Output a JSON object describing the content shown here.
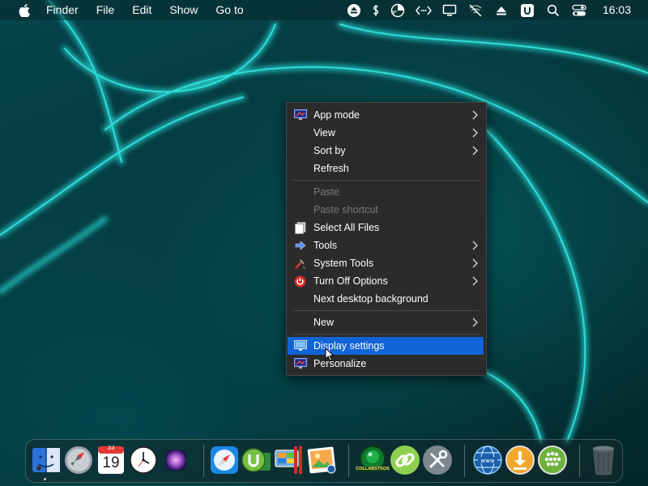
{
  "menubar": {
    "app_name": "Finder",
    "menus": [
      "File",
      "Edit",
      "Show",
      "Go to"
    ],
    "status_icons": [
      "eject-icon",
      "dollar-icon",
      "pie-chart-icon",
      "code-arrows-icon",
      "display-icon",
      "mute-network-icon",
      "upload-icon",
      "u-badge-icon",
      "search-icon",
      "control-center-icon"
    ],
    "clock": "16:03"
  },
  "context_menu": {
    "groups": [
      [
        {
          "label": "App mode",
          "icon": "app-mode-icon",
          "submenu": true,
          "enabled": true
        },
        {
          "label": "View",
          "icon": "",
          "submenu": true,
          "enabled": true
        },
        {
          "label": "Sort by",
          "icon": "",
          "submenu": true,
          "enabled": true
        },
        {
          "label": "Refresh",
          "icon": "",
          "submenu": false,
          "enabled": true
        }
      ],
      [
        {
          "label": "Paste",
          "icon": "",
          "submenu": false,
          "enabled": false
        },
        {
          "label": "Paste shortcut",
          "icon": "",
          "submenu": false,
          "enabled": false
        },
        {
          "label": "Select All Files",
          "icon": "select-files-icon",
          "submenu": false,
          "enabled": true
        },
        {
          "label": "Tools",
          "icon": "tools-arrow-icon",
          "submenu": true,
          "enabled": true
        },
        {
          "label": "System Tools",
          "icon": "system-tools-icon",
          "submenu": true,
          "enabled": true
        },
        {
          "label": "Turn Off Options",
          "icon": "power-icon",
          "submenu": true,
          "enabled": true
        },
        {
          "label": "Next desktop background",
          "icon": "",
          "submenu": false,
          "enabled": true
        }
      ],
      [
        {
          "label": "New",
          "icon": "",
          "submenu": true,
          "enabled": true
        }
      ],
      [
        {
          "label": "Display settings",
          "icon": "display-settings-icon",
          "submenu": false,
          "enabled": true,
          "selected": true
        },
        {
          "label": "Personalize",
          "icon": "personalize-icon",
          "submenu": false,
          "enabled": true
        }
      ]
    ]
  },
  "dock": {
    "calendar_month": "Jul",
    "calendar_day": "19",
    "collab_label": "COLLABSTSOS",
    "items": [
      "finder-icon",
      "launchpad-icon",
      "calendar-icon",
      "clock-icon",
      "siri-icon",
      "safari-icon",
      "utorrent-icon",
      "parallels-icon",
      "photo-viewer-icon",
      "collabstsos-icon",
      "link-icon",
      "utilities-icon",
      "network-globe-icon",
      "downloads-icon",
      "app-store-icon",
      "trash-icon"
    ]
  },
  "colors": {
    "menu_background": "#2b2b2b",
    "selection": "#1064d6",
    "wallpaper_glow": "#2fe6e0"
  }
}
